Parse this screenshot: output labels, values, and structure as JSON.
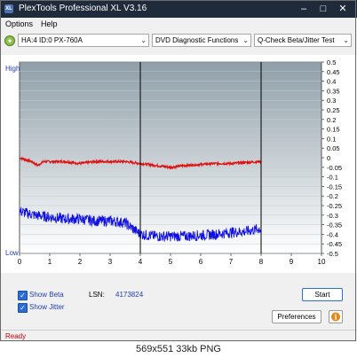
{
  "window": {
    "title": "PlexTools Professional XL V3.16",
    "app_icon": "XL"
  },
  "menu": [
    {
      "label": "Options",
      "key": "O"
    },
    {
      "label": "Help",
      "key": "H"
    }
  ],
  "toolbar": {
    "drive": "HA:4 ID:0  PX-760A",
    "function": "DVD Diagnostic Functions",
    "test": "Q-Check Beta/Jitter Test",
    "drive_icon": "disc-drive-icon"
  },
  "chart": {
    "high_label": "High",
    "low_label": "Low",
    "x_ticks": [
      "0",
      "1",
      "2",
      "3",
      "4",
      "5",
      "6",
      "7",
      "8",
      "9",
      "10"
    ],
    "y_ticks": [
      "0.5",
      "0.45",
      "0.4",
      "0.35",
      "0.3",
      "0.25",
      "0.2",
      "0.15",
      "0.1",
      "0.05",
      "0",
      "-0.05",
      "-0.1",
      "-0.15",
      "-0.2",
      "-0.25",
      "-0.3",
      "-0.35",
      "-0.4",
      "-0.45",
      "-0.5"
    ],
    "colors": {
      "beta": "#e01010",
      "jitter": "#1010e0",
      "marker": "#000000",
      "bg_top": "#8e9ea8",
      "bg_bottom": "#ffffff"
    }
  },
  "chart_data": {
    "type": "line",
    "xlim": [
      0,
      10
    ],
    "ylim": [
      -0.5,
      0.5
    ],
    "grid": true,
    "series": [
      {
        "x": [
          0,
          0.4,
          0.6,
          0.8,
          1,
          1.5,
          2,
          2.5,
          3,
          3.5,
          4,
          4.5,
          5,
          5.5,
          6,
          6.5,
          7,
          7.5,
          8
        ],
        "values": [
          0.0,
          -0.02,
          -0.04,
          -0.02,
          -0.02,
          -0.02,
          -0.03,
          -0.02,
          -0.02,
          -0.02,
          -0.03,
          -0.04,
          -0.05,
          -0.04,
          -0.035,
          -0.03,
          -0.03,
          -0.025,
          -0.02
        ]
      },
      {
        "x": [
          0,
          0.5,
          1,
          1.5,
          2,
          2.5,
          3,
          3.5,
          4,
          4.5,
          5,
          5.5,
          6,
          6.5,
          7,
          7.5,
          8
        ],
        "values": [
          -0.28,
          -0.3,
          -0.31,
          -0.32,
          -0.32,
          -0.33,
          -0.33,
          -0.34,
          -0.4,
          -0.41,
          -0.41,
          -0.41,
          -0.405,
          -0.4,
          -0.39,
          -0.385,
          -0.37
        ]
      }
    ],
    "markers_x": [
      4,
      8
    ]
  },
  "controls": {
    "show_beta": "Show Beta",
    "show_jitter": "Show Jitter",
    "lsn_label": "LSN:",
    "lsn_value": "4173824",
    "start": "Start",
    "preferences": "Preferences",
    "info_icon": "info-icon"
  },
  "status": "Ready",
  "caption": "569x551  33kb  PNG"
}
